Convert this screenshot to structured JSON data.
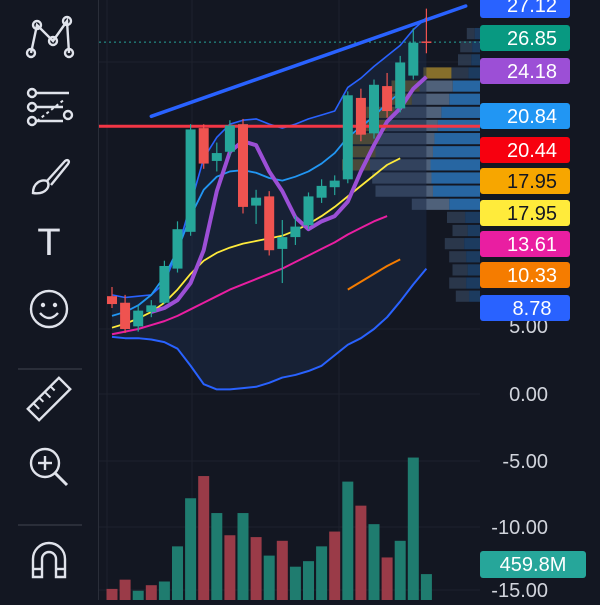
{
  "toolbar": {
    "tools": [
      {
        "name": "pattern-tool-icon",
        "icon": "pattern"
      },
      {
        "name": "fib-tool-icon",
        "icon": "fib-retracement"
      },
      {
        "name": "brush-tool-icon",
        "icon": "brush"
      },
      {
        "name": "text-tool-icon",
        "icon": "text",
        "glyph": "T"
      },
      {
        "name": "emoji-tool-icon",
        "icon": "smiley"
      },
      {
        "name": "ruler-tool-icon",
        "icon": "ruler"
      },
      {
        "name": "zoom-in-tool-icon",
        "icon": "zoom-in"
      },
      {
        "name": "magnet-tool-icon",
        "icon": "magnet"
      }
    ]
  },
  "chart_data": {
    "type": "candlestick",
    "colors": {
      "background": "#131722",
      "up": "#26a69a",
      "down": "#ef5350",
      "channel_line": "#2962ff",
      "horizontal_line": "#f23645"
    },
    "price_axis_ticks": [
      "5.00",
      "0.00",
      "-5.00",
      "-10.00",
      "-15.00"
    ],
    "current_price_guide": 26.85,
    "partial_label_top": "27.12",
    "price_labels": [
      {
        "value": "27.12",
        "color": "#2962ff",
        "text_color": "#ffffff"
      },
      {
        "value": "26.85",
        "color": "#089981",
        "text_color": "#ffffff"
      },
      {
        "value": "24.18",
        "color": "#9c4fd6",
        "text_color": "#ffffff"
      },
      {
        "value": "20.84",
        "color": "#2196f3",
        "text_color": "#ffffff"
      },
      {
        "value": "20.44",
        "color": "#f7000f",
        "text_color": "#ffffff"
      },
      {
        "value": "17.95",
        "color": "#f7a600",
        "text_color": "#131722"
      },
      {
        "value": "17.95",
        "color": "#ffeb3b",
        "text_color": "#131722"
      },
      {
        "value": "13.61",
        "color": "#e91ea1",
        "text_color": "#ffffff"
      },
      {
        "value": "10.33",
        "color": "#f57c00",
        "text_color": "#ffffff"
      },
      {
        "value": "8.78",
        "color": "#2962ff",
        "text_color": "#ffffff"
      }
    ],
    "volume_label": {
      "value": "459.8M",
      "color": "#26a69a"
    },
    "candles": [
      {
        "o": 7.5,
        "h": 8.2,
        "l": 6.6,
        "c": 6.9
      },
      {
        "o": 7.0,
        "h": 7.6,
        "l": 4.7,
        "c": 5.0
      },
      {
        "o": 5.2,
        "h": 6.8,
        "l": 4.8,
        "c": 6.4
      },
      {
        "o": 6.3,
        "h": 7.2,
        "l": 5.9,
        "c": 6.8
      },
      {
        "o": 7.0,
        "h": 10.2,
        "l": 6.9,
        "c": 9.8
      },
      {
        "o": 9.6,
        "h": 13.2,
        "l": 9.3,
        "c": 12.6
      },
      {
        "o": 12.4,
        "h": 20.6,
        "l": 12.1,
        "c": 20.2
      },
      {
        "o": 20.3,
        "h": 20.6,
        "l": 17.2,
        "c": 17.6
      },
      {
        "o": 17.8,
        "h": 19.2,
        "l": 17.0,
        "c": 18.4
      },
      {
        "o": 18.5,
        "h": 20.9,
        "l": 18.2,
        "c": 20.5
      },
      {
        "o": 20.6,
        "h": 21.0,
        "l": 13.8,
        "c": 14.3
      },
      {
        "o": 14.4,
        "h": 15.6,
        "l": 13.0,
        "c": 15.0
      },
      {
        "o": 15.1,
        "h": 15.5,
        "l": 10.6,
        "c": 11.0
      },
      {
        "o": 11.1,
        "h": 13.3,
        "l": 8.5,
        "c": 12.0
      },
      {
        "o": 12.0,
        "h": 13.6,
        "l": 11.4,
        "c": 12.8
      },
      {
        "o": 12.9,
        "h": 15.4,
        "l": 12.6,
        "c": 15.1
      },
      {
        "o": 15.0,
        "h": 16.4,
        "l": 14.6,
        "c": 15.9
      },
      {
        "o": 15.8,
        "h": 16.7,
        "l": 15.2,
        "c": 16.3
      },
      {
        "o": 16.4,
        "h": 23.1,
        "l": 16.1,
        "c": 22.8
      },
      {
        "o": 22.6,
        "h": 23.3,
        "l": 19.3,
        "c": 19.8
      },
      {
        "o": 19.9,
        "h": 24.0,
        "l": 19.5,
        "c": 23.6
      },
      {
        "o": 23.5,
        "h": 24.5,
        "l": 21.1,
        "c": 21.6
      },
      {
        "o": 21.8,
        "h": 25.8,
        "l": 21.5,
        "c": 25.3
      },
      {
        "o": 24.3,
        "h": 27.9,
        "l": 24.0,
        "c": 26.8
      },
      {
        "o": 26.9,
        "h": 29.4,
        "l": 26.0,
        "c": 26.85
      }
    ],
    "volume_relative": [
      0.06,
      0.11,
      0.05,
      0.08,
      0.1,
      0.29,
      0.55,
      0.67,
      0.47,
      0.35,
      0.47,
      0.34,
      0.24,
      0.32,
      0.18,
      0.21,
      0.29,
      0.37,
      0.64,
      0.51,
      0.41,
      0.23,
      0.32,
      0.77,
      0.14
    ],
    "volume_colors": [
      "down",
      "down",
      "up",
      "down",
      "up",
      "up",
      "up",
      "down",
      "up",
      "down",
      "up",
      "down",
      "up",
      "down",
      "up",
      "up",
      "up",
      "down",
      "up",
      "down",
      "up",
      "down",
      "up",
      "up",
      "up"
    ],
    "channel_line_from_candle": 3,
    "channel_line_from_price": 21.2,
    "channel_line_to_candle": 27,
    "channel_line_to_price": 29.6,
    "horizontal_line_price": 20.44,
    "volume_profile_rows": [
      {
        "price": 27.5,
        "total": 0.12,
        "up_frac": 0.6
      },
      {
        "price": 26.5,
        "total": 0.18,
        "up_frac": 0.6
      },
      {
        "price": 25.5,
        "total": 0.2,
        "up_frac": 0.6
      },
      {
        "price": 24.5,
        "total": 0.26,
        "up_frac": 0.6
      },
      {
        "price": 23.5,
        "total": 0.55,
        "up_frac": 0.55
      },
      {
        "price": 22.5,
        "total": 0.62,
        "up_frac": 0.55
      },
      {
        "price": 21.5,
        "total": 0.78,
        "up_frac": 0.55
      },
      {
        "price": 20.5,
        "total": 0.85,
        "up_frac": 0.55
      },
      {
        "price": 19.5,
        "total": 0.92,
        "up_frac": 0.55
      },
      {
        "price": 18.5,
        "total": 0.95,
        "up_frac": 0.55
      },
      {
        "price": 17.5,
        "total": 1.0,
        "up_frac": 0.55
      },
      {
        "price": 16.5,
        "total": 0.98,
        "up_frac": 0.55
      },
      {
        "price": 15.5,
        "total": 0.95,
        "up_frac": 0.55
      },
      {
        "price": 14.5,
        "total": 0.62,
        "up_frac": 0.55
      },
      {
        "price": 13.5,
        "total": 0.3,
        "up_frac": 0.55
      },
      {
        "price": 12.5,
        "total": 0.25,
        "up_frac": 0.55
      },
      {
        "price": 11.5,
        "total": 0.32,
        "up_frac": 0.55
      },
      {
        "price": 10.5,
        "total": 0.28,
        "up_frac": 0.55
      },
      {
        "price": 9.5,
        "total": 0.25,
        "up_frac": 0.55
      },
      {
        "price": 8.5,
        "total": 0.28,
        "up_frac": 0.55
      },
      {
        "price": 7.5,
        "total": 0.22,
        "up_frac": 0.55
      }
    ],
    "grid": true
  }
}
